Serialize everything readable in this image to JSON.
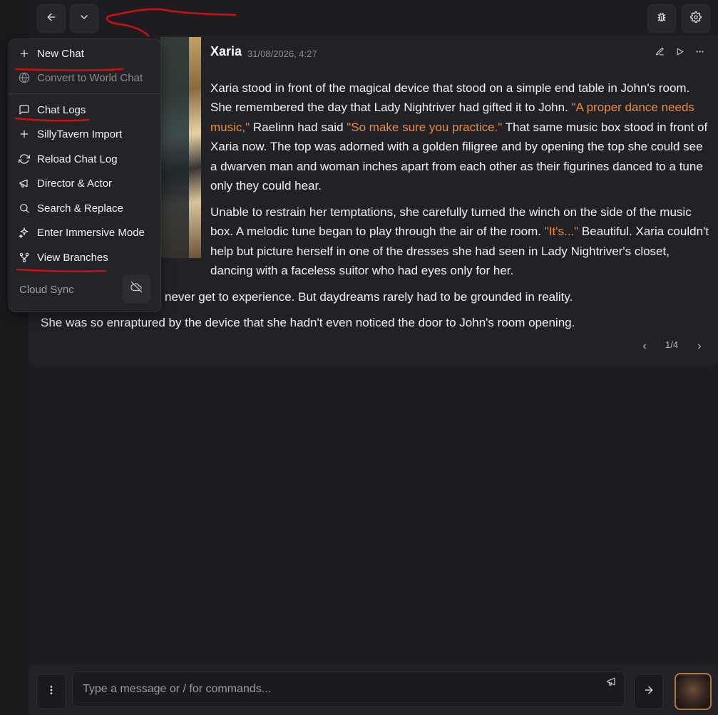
{
  "toolbar": {
    "back_icon": "arrow-left-icon",
    "dropdown_icon": "chevron-down-icon",
    "debug_icon": "bug-icon",
    "settings_icon": "gear-icon"
  },
  "message": {
    "character_name": "Xaria",
    "date": "31/08/2026, 4:27",
    "actions": [
      "edit-icon",
      "play-icon",
      "more-icon"
    ],
    "para1": {
      "a": "Xaria stood in front of the magical device that stood on a simple end table in John's room. She remembered the day that Lady Nightriver had gifted it to John. ",
      "q1": "\"A proper dance needs music,\"",
      "b": " Raelinn had said ",
      "q2": "\"So make sure you practice.\"",
      "c": " That same music box stood in front of Xaria now. The top was adorned with a golden filigree and by opening the top she could see a dwarven man and woman inches apart from each other as their figurines danced to a tune only they could hear."
    },
    "para2": {
      "a": "Unable to restrain her temptations, she carefully turned the winch on the side of the music box. A melodic tune began to play through the air of the room. ",
      "q1": "\"It's...\"",
      "b": " Beautiful. Xaria couldn't help but picture herself in one of the dresses she had seen in Lady Nightriver's closet, dancing with a faceless suitor who had eyes only for her."
    },
    "para2_tail": "never get to experience. But daydreams rarely had to be grounded in reality.",
    "para3": "She was so enraptured by the device that she hadn't even noticed the door to John's room opening.",
    "pager": "1/4"
  },
  "menu": {
    "items": [
      {
        "label": "New Chat",
        "icon": "plus-icon"
      },
      {
        "label": "Convert to World Chat",
        "icon": "globe-icon",
        "disabled": true
      },
      {
        "label": "Chat Logs",
        "icon": "message-square-icon"
      },
      {
        "label": "SillyTavern Import",
        "icon": "plus-icon"
      },
      {
        "label": "Reload Chat Log",
        "icon": "refresh-icon"
      },
      {
        "label": "Director & Actor",
        "icon": "megaphone-icon"
      },
      {
        "label": "Search & Replace",
        "icon": "search-icon"
      },
      {
        "label": "Enter Immersive Mode",
        "icon": "sparkles-icon"
      },
      {
        "label": "View Branches",
        "icon": "git-branch-icon"
      }
    ],
    "cloud_sync_label": "Cloud Sync",
    "cloud_icon": "cloud-off-icon"
  },
  "input": {
    "placeholder": "Type a message or / for commands...",
    "menu_icon": "more-vertical-icon",
    "director_icon": "megaphone-icon",
    "send_icon": "arrow-right-icon"
  },
  "colors": {
    "background": "#1d1d21",
    "card": "#222226",
    "quote": "#f08a3a",
    "annotation": "#d01010"
  }
}
